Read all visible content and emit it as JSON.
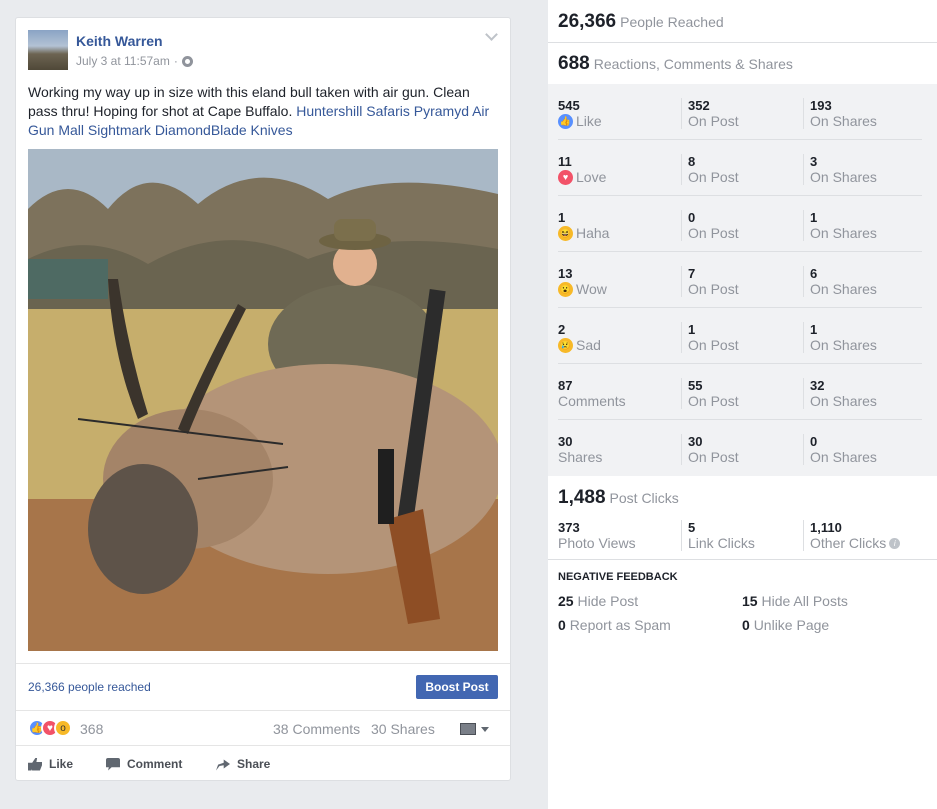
{
  "post": {
    "author": "Keith Warren",
    "timestamp": "July 3 at 11:57am",
    "separator": "·",
    "text": "Working my way up in size with this eland bull taken with air gun. Clean pass thru! Hoping for shot at Cape Buffalo.",
    "tags": "Huntershill Safaris Pyramyd Air Gun Mall Sightmark DiamondBlade Knives",
    "people_reached": "26,366 people reached",
    "boost_label": "Boost Post",
    "reaction_count": "368",
    "comments": "38 Comments",
    "shares": "30 Shares",
    "actions": {
      "like": "Like",
      "comment": "Comment",
      "share": "Share"
    },
    "icons": [
      "globe-icon",
      "chevron-down-icon",
      "like-icon",
      "love-icon",
      "wow-icon",
      "comment-icon",
      "share-icon"
    ]
  },
  "stats": {
    "reached": {
      "value": "26,366",
      "label": "People Reached"
    },
    "engagement": {
      "value": "688",
      "label": "Reactions, Comments & Shares"
    },
    "rows": [
      {
        "total": "545",
        "label": "Like",
        "icon": "like-icon",
        "on_post": "352",
        "on_post_label": "On Post",
        "on_shares": "193",
        "on_shares_label": "On Shares"
      },
      {
        "total": "11",
        "label": "Love",
        "icon": "love-icon",
        "on_post": "8",
        "on_post_label": "On Post",
        "on_shares": "3",
        "on_shares_label": "On Shares"
      },
      {
        "total": "1",
        "label": "Haha",
        "icon": "haha-icon",
        "on_post": "0",
        "on_post_label": "On Post",
        "on_shares": "1",
        "on_shares_label": "On Shares"
      },
      {
        "total": "13",
        "label": "Wow",
        "icon": "wow-icon",
        "on_post": "7",
        "on_post_label": "On Post",
        "on_shares": "6",
        "on_shares_label": "On Shares"
      },
      {
        "total": "2",
        "label": "Sad",
        "icon": "sad-icon",
        "on_post": "1",
        "on_post_label": "On Post",
        "on_shares": "1",
        "on_shares_label": "On Shares"
      },
      {
        "total": "87",
        "label": "Comments",
        "icon": "",
        "on_post": "55",
        "on_post_label": "On Post",
        "on_shares": "32",
        "on_shares_label": "On Shares"
      },
      {
        "total": "30",
        "label": "Shares",
        "icon": "",
        "on_post": "30",
        "on_post_label": "On Post",
        "on_shares": "0",
        "on_shares_label": "On Shares"
      }
    ],
    "post_clicks": {
      "value": "1,488",
      "label": "Post Clicks"
    },
    "clicks": [
      {
        "value": "373",
        "label": "Photo Views"
      },
      {
        "value": "5",
        "label": "Link Clicks"
      },
      {
        "value": "1,110",
        "label": "Other Clicks"
      }
    ],
    "negative": {
      "title": "NEGATIVE FEEDBACK",
      "hide_post": {
        "value": "25",
        "label": "Hide Post"
      },
      "hide_all": {
        "value": "15",
        "label": "Hide All Posts"
      },
      "spam": {
        "value": "0",
        "label": "Report as Spam"
      },
      "unlike": {
        "value": "0",
        "label": "Unlike Page"
      }
    }
  },
  "colors": {
    "link": "#365899",
    "boost": "#4267b2",
    "like": "#5890ff",
    "love": "#f25268",
    "wow": "#f7b928"
  }
}
